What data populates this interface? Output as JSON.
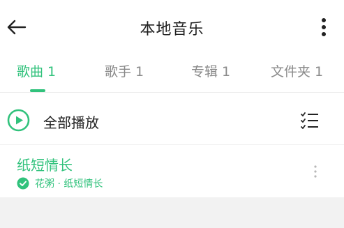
{
  "header": {
    "title": "本地音乐",
    "back_icon": "arrow-left-icon",
    "more_icon": "more-vertical-icon"
  },
  "tabs": [
    {
      "label": "歌曲 1",
      "active": true
    },
    {
      "label": "歌手 1",
      "active": false
    },
    {
      "label": "专辑 1",
      "active": false
    },
    {
      "label": "文件夹 1",
      "active": false
    }
  ],
  "play_all": {
    "label": "全部播放",
    "play_icon": "play-circle-icon",
    "manage_icon": "list-select-icon"
  },
  "songs": [
    {
      "title": "纸短情长",
      "subtitle": "花粥 · 纸短情长",
      "downloaded": true,
      "more_icon": "more-vertical-icon"
    }
  ],
  "colors": {
    "accent": "#31c27c",
    "text": "#222222",
    "inactive_tab": "#8a8a8a",
    "background_lower": "#f2f2f2"
  }
}
